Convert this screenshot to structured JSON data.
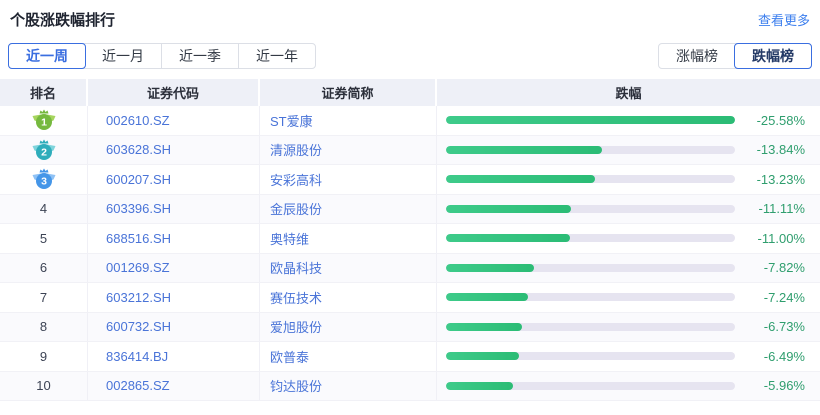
{
  "header": {
    "title": "个股涨跌幅排行",
    "more_link": "查看更多"
  },
  "period_tabs": {
    "items": [
      {
        "label": "近一周",
        "selected": true
      },
      {
        "label": "近一月",
        "selected": false
      },
      {
        "label": "近一季",
        "selected": false
      },
      {
        "label": "近一年",
        "selected": false
      }
    ]
  },
  "board_tabs": {
    "items": [
      {
        "label": "涨幅榜",
        "selected": false
      },
      {
        "label": "跌幅榜",
        "selected": true
      }
    ]
  },
  "table": {
    "columns": [
      "排名",
      "证券代码",
      "证券简称",
      "跌幅"
    ],
    "max_abs_change": 25.58,
    "rows": [
      {
        "rank": 1,
        "code": "002610.SZ",
        "name": "ST爱康",
        "change": "-25.58%",
        "value": -25.58
      },
      {
        "rank": 2,
        "code": "603628.SH",
        "name": "清源股份",
        "change": "-13.84%",
        "value": -13.84
      },
      {
        "rank": 3,
        "code": "600207.SH",
        "name": "安彩高科",
        "change": "-13.23%",
        "value": -13.23
      },
      {
        "rank": 4,
        "code": "603396.SH",
        "name": "金辰股份",
        "change": "-11.11%",
        "value": -11.11
      },
      {
        "rank": 5,
        "code": "688516.SH",
        "name": "奥特维",
        "change": "-11.00%",
        "value": -11.0
      },
      {
        "rank": 6,
        "code": "001269.SZ",
        "name": "欧晶科技",
        "change": "-7.82%",
        "value": -7.82
      },
      {
        "rank": 7,
        "code": "603212.SH",
        "name": "赛伍技术",
        "change": "-7.24%",
        "value": -7.24
      },
      {
        "rank": 8,
        "code": "600732.SH",
        "name": "爱旭股份",
        "change": "-6.73%",
        "value": -6.73
      },
      {
        "rank": 9,
        "code": "836414.BJ",
        "name": "欧普泰",
        "change": "-6.49%",
        "value": -6.49
      },
      {
        "rank": 10,
        "code": "002865.SZ",
        "name": "钧达股份",
        "change": "-5.96%",
        "value": -5.96
      }
    ]
  },
  "medals": {
    "1": {
      "body": "#76b93f",
      "wing": "#a6d55e"
    },
    "2": {
      "body": "#2fadbb",
      "wing": "#7fd4dc"
    },
    "3": {
      "body": "#4596e8",
      "wing": "#8fc2f5"
    }
  },
  "colors": {
    "accent_blue": "#3a6ee0",
    "link_blue": "#4a74d8",
    "bar_fill": "#30bf7c",
    "bar_track": "#e6e4f0",
    "change_text": "#2f9e6e"
  }
}
